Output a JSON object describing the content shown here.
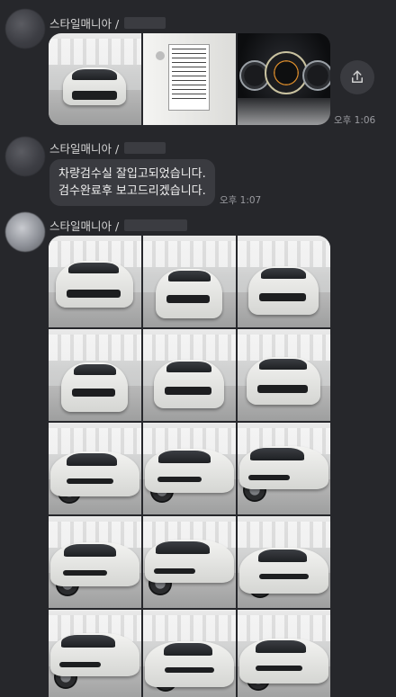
{
  "messages": [
    {
      "sender": "스타일매니아 /",
      "type": "images",
      "image_count": 3,
      "image_subjects": [
        "car-front-studio",
        "vin-sticker",
        "instrument-cluster"
      ],
      "time": "오후 1:06"
    },
    {
      "sender": "스타일매니아 /",
      "type": "text",
      "lines": [
        "차량검수실 잘입고되었습니다.",
        "검수완료후 보고드리겠습니다."
      ],
      "time": "오후 1:07"
    },
    {
      "sender": "스타일매니아 /",
      "type": "image-grid",
      "columns": 3,
      "visible_rows": 5,
      "image_count": 15
    }
  ],
  "share_button": {
    "icon": "share-icon"
  },
  "colors": {
    "background": "#26272b",
    "bubble": "#3a3b40",
    "text": "#e6e6e6",
    "time": "#9a9ba0"
  }
}
